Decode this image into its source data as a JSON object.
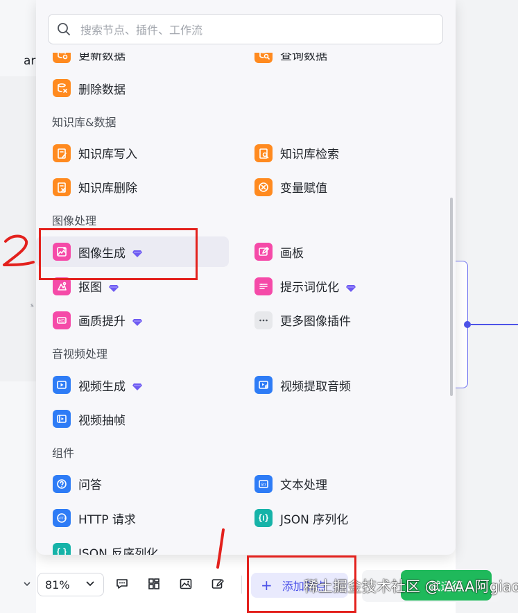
{
  "canvas": {
    "left_partial_text": "ar",
    "left_tag": "s"
  },
  "search": {
    "placeholder": "搜索节点、插件、工作流"
  },
  "sections": [
    {
      "title": "",
      "items": [
        {
          "label": "更新数据",
          "icon": "database-update-icon",
          "color": "#ff8a1f",
          "premium": false
        },
        {
          "label": "查询数据",
          "icon": "database-query-icon",
          "color": "#ff8a1f",
          "premium": false
        },
        {
          "label": "删除数据",
          "icon": "database-delete-icon",
          "color": "#ff8a1f",
          "premium": false
        }
      ]
    },
    {
      "title": "知识库&数据",
      "items": [
        {
          "label": "知识库写入",
          "icon": "knowledge-write-icon",
          "color": "#ff8a1f",
          "premium": false
        },
        {
          "label": "知识库检索",
          "icon": "knowledge-search-icon",
          "color": "#ff8a1f",
          "premium": false
        },
        {
          "label": "知识库删除",
          "icon": "knowledge-delete-icon",
          "color": "#ff8a1f",
          "premium": false
        },
        {
          "label": "变量赋值",
          "icon": "variable-assign-icon",
          "color": "#ff8a1f",
          "premium": false
        }
      ]
    },
    {
      "title": "图像处理",
      "items": [
        {
          "label": "图像生成",
          "icon": "image-generate-icon",
          "color": "#f54aa8",
          "premium": true
        },
        {
          "label": "画板",
          "icon": "canvas-board-icon",
          "color": "#f54aa8",
          "premium": false
        },
        {
          "label": "抠图",
          "icon": "cutout-icon",
          "color": "#f54aa8",
          "premium": true
        },
        {
          "label": "提示词优化",
          "icon": "prompt-optimize-icon",
          "color": "#f54aa8",
          "premium": true
        },
        {
          "label": "画质提升",
          "icon": "hd-upscale-icon",
          "color": "#f54aa8",
          "premium": true
        },
        {
          "label": "更多图像插件",
          "icon": "more-icon",
          "color": "#e7e8eb",
          "premium": false
        }
      ]
    },
    {
      "title": "音视频处理",
      "items": [
        {
          "label": "视频生成",
          "icon": "video-generate-icon",
          "color": "#2e7cf6",
          "premium": true
        },
        {
          "label": "视频提取音频",
          "icon": "video-audio-icon",
          "color": "#2e7cf6",
          "premium": false
        },
        {
          "label": "视频抽帧",
          "icon": "video-frame-icon",
          "color": "#2e7cf6",
          "premium": false
        }
      ]
    },
    {
      "title": "组件",
      "items": [
        {
          "label": "问答",
          "icon": "question-icon",
          "color": "#2e7cf6",
          "premium": false
        },
        {
          "label": "文本处理",
          "icon": "text-process-icon",
          "color": "#2e7cf6",
          "premium": false
        },
        {
          "label": "HTTP 请求",
          "icon": "http-icon",
          "color": "#2e7cf6",
          "premium": false
        },
        {
          "label": "JSON 序列化",
          "icon": "json-serialize-icon",
          "color": "#16b3a8",
          "premium": false
        },
        {
          "label": "JSON 反序列化",
          "icon": "json-deserialize-icon",
          "color": "#16b3a8",
          "premium": false
        }
      ]
    }
  ],
  "toolbar": {
    "zoom": "81%",
    "add_node_label": "添加节点",
    "run_label": "试运行"
  },
  "watermark": "稀土掘金技术社区 @ AAA阿giao",
  "annotations": {
    "mark_1": "1",
    "mark_2": "2"
  }
}
